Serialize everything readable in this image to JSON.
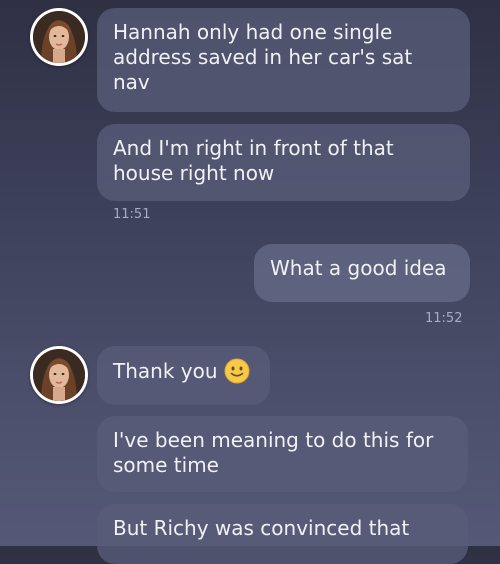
{
  "messages": [
    {
      "text": "Hannah only had one single address saved in her car's sat nav"
    },
    {
      "text": "And I'm right in front of that house right now"
    },
    {
      "text": "What a good idea"
    },
    {
      "text": "Thank you"
    },
    {
      "text": "I've been meaning to do this for some time"
    },
    {
      "text": "But Richy was convinced that"
    }
  ],
  "times": [
    "11:51",
    "11:52"
  ],
  "icons": {
    "avatar": "contact-avatar",
    "emoji": "slightly-smiling-face-emoji"
  },
  "colors": {
    "background_top": "#2f3044",
    "background_bottom": "#545977",
    "bubble": "#585c78",
    "text": "#f1f1f5",
    "timestamp": "#a8acc2"
  }
}
